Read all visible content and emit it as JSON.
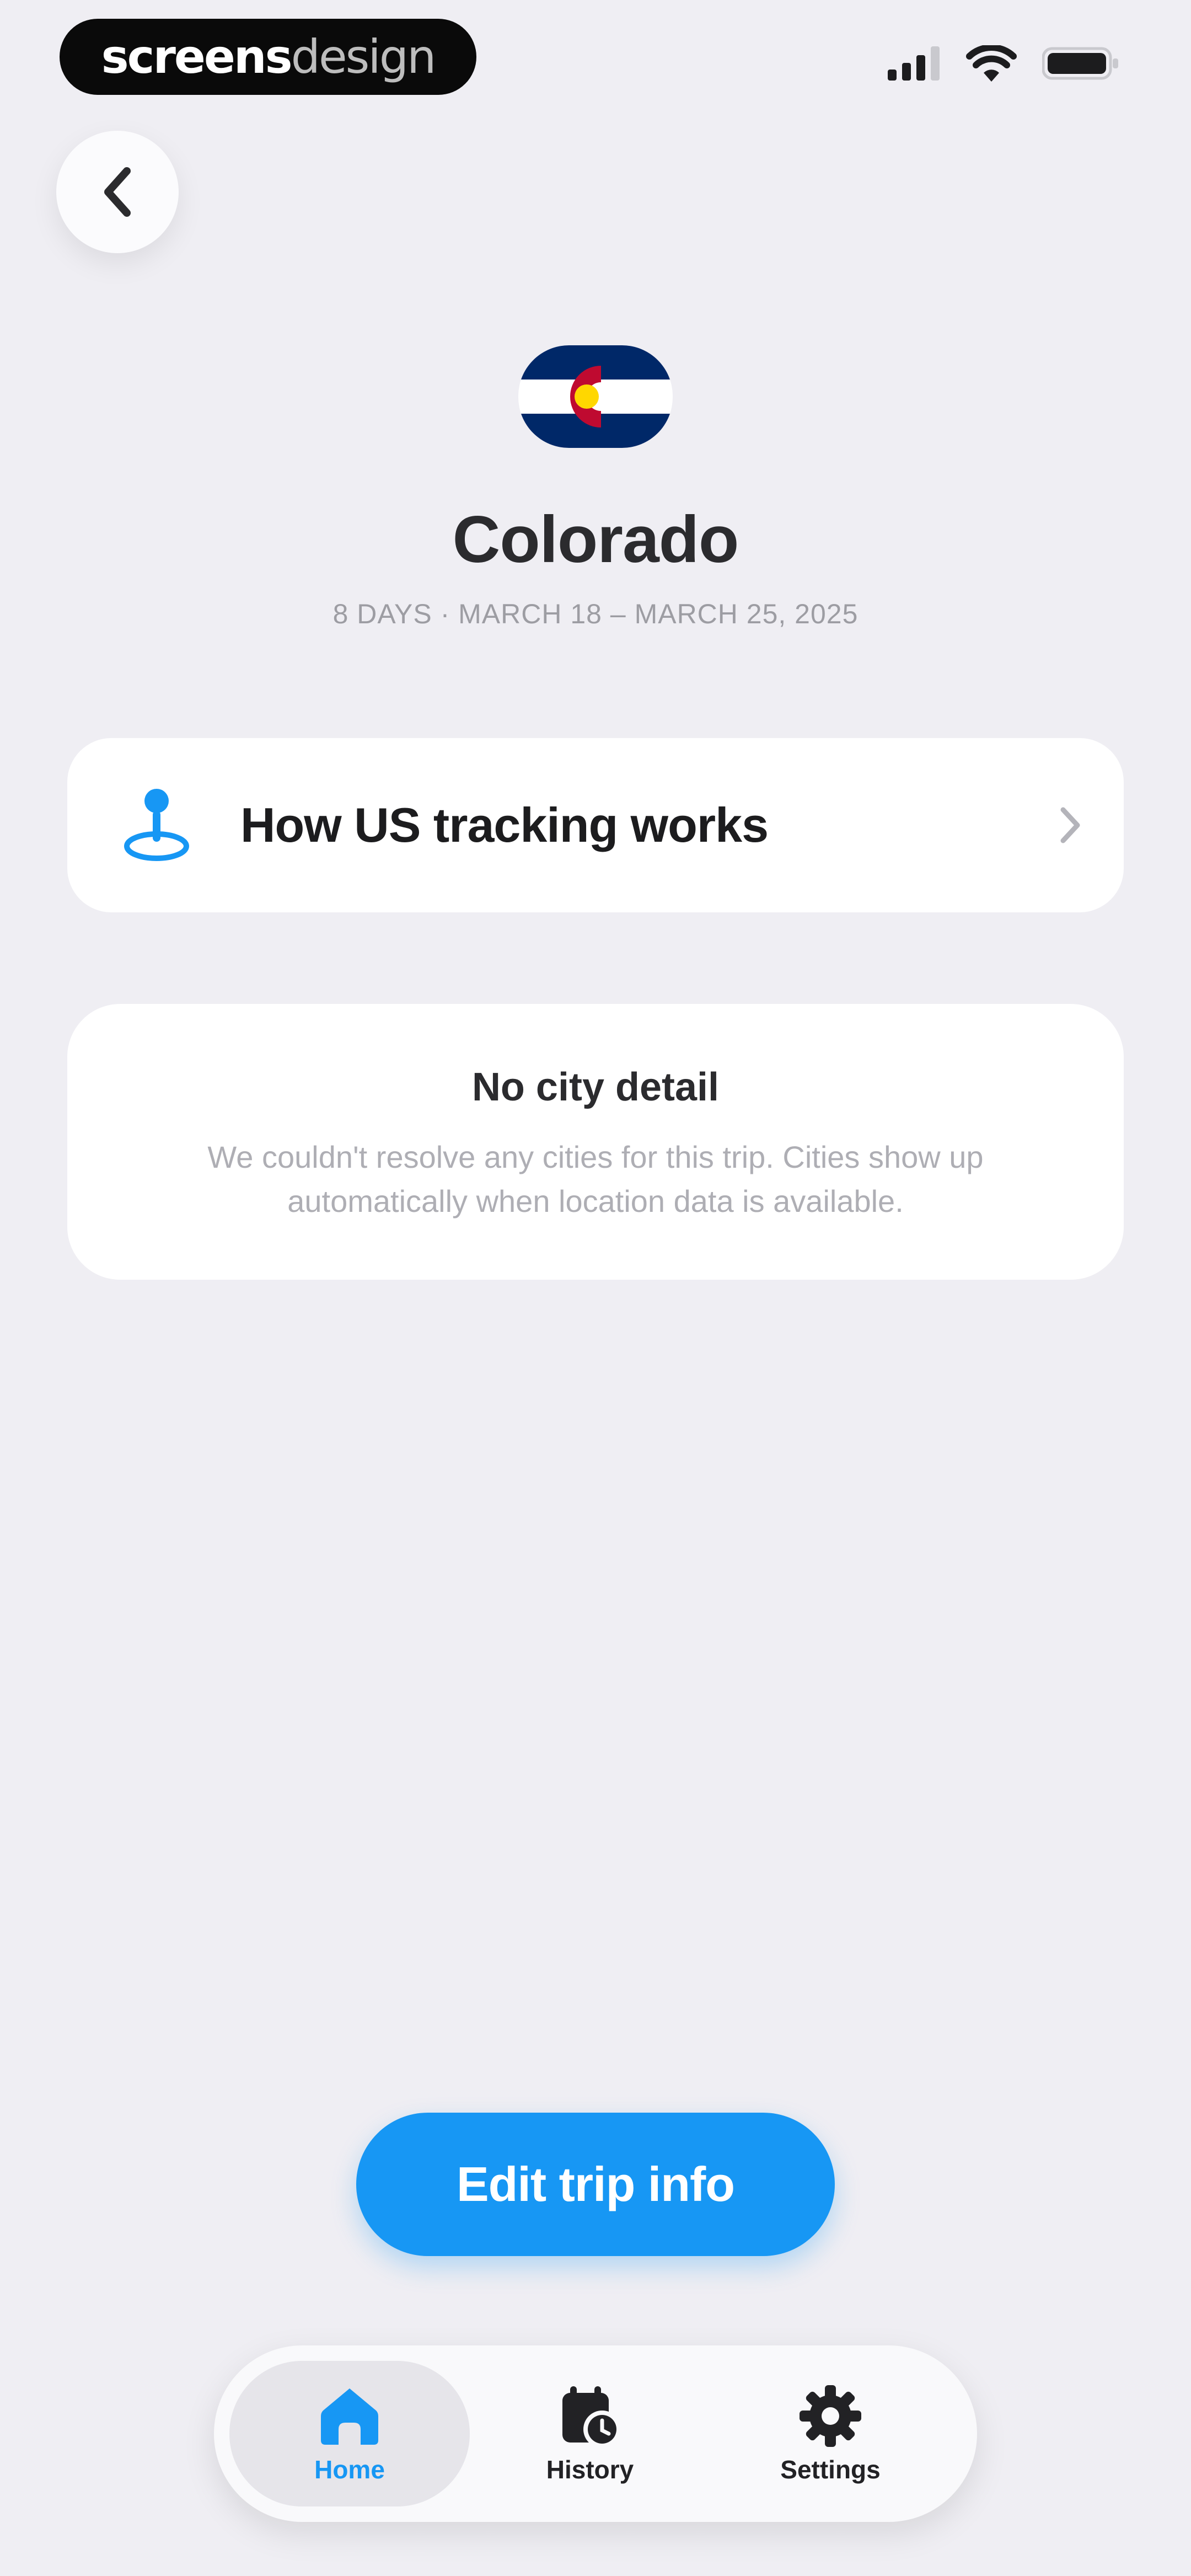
{
  "status_bar": {
    "watermark_bold": "screens",
    "watermark_light": "design",
    "icons": [
      "cellular-signal-icon",
      "wifi-icon",
      "battery-icon"
    ]
  },
  "header": {
    "back_icon": "chevron-left-icon",
    "flag_icon": "colorado-flag",
    "title": "Colorado",
    "subtitle": "8 DAYS · MARCH 18 – MARCH 25, 2025"
  },
  "info_row": {
    "icon": "map-pin-icon",
    "label": "How US tracking works",
    "chevron_icon": "chevron-right-icon"
  },
  "empty_state": {
    "heading": "No city detail",
    "body": "We couldn't resolve any cities for this trip. Cities show up automatically when location data is available."
  },
  "primary_action": {
    "label": "Edit trip info"
  },
  "tab_bar": {
    "tabs": [
      {
        "label": "Home",
        "icon": "home-icon",
        "active": true
      },
      {
        "label": "History",
        "icon": "calendar-clock-icon",
        "active": false
      },
      {
        "label": "Settings",
        "icon": "gear-icon",
        "active": false
      }
    ]
  },
  "colors": {
    "background": "#efeef3",
    "accent": "#1797f4",
    "card": "#ffffff",
    "flag_blue": "#002868",
    "flag_red": "#bf0a30",
    "flag_gold": "#ffd700"
  }
}
